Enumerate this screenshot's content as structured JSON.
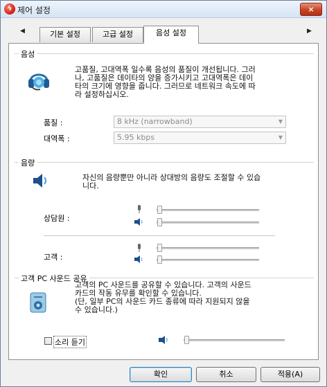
{
  "window": {
    "title": "제어 설정",
    "close_label": "×"
  },
  "tabs": [
    {
      "label": "기본 설정"
    },
    {
      "label": "고급 설정"
    },
    {
      "label": "음성 설정"
    }
  ],
  "active_tab": "음성 설정",
  "voice_group": {
    "title": "음성",
    "description_lines": [
      "고품질, 고대역폭 일수록 음성의 품질이 개선됩니다. 그러",
      "나, 고품질은 데이타의 양을 증가시키고 고대역폭은 데이",
      "타의 크기에 영향을 줍니다. 그러므로 네트워크 속도에 따",
      "라 설정하십시오."
    ],
    "quality_label": "품질 :",
    "quality_value": "8 kHz (narrowband)",
    "bandwidth_label": "대역폭 :",
    "bandwidth_value": "5.95 kbps"
  },
  "volume_group": {
    "title": "음량",
    "description_lines": [
      "자신의 음량뿐만 아니라 상대방의 음량도 조절할 수 있습",
      "니다."
    ],
    "remote_label": "상담원 :",
    "client_label": "고객 :",
    "levels": {
      "remote_mic": 0,
      "remote_speaker": 0,
      "client_mic": 0,
      "client_speaker": 0
    }
  },
  "pc_sound_group": {
    "title": "고객 PC 사운드 공유",
    "description_lines": [
      "고객의 PC 사운드를 공유할 수 있습니다. 고객의 사운드",
      "카드의 작동 유무를 확인할 수 있습니다.",
      "(단, 일부 PC의 사운드 카드 종류에 따라 지원되지 않을",
      "수 있습니다.)"
    ],
    "listen_checkbox_label": "소리 듣기",
    "listen_checked": false,
    "listen_level": 0
  },
  "buttons": {
    "ok": "확인",
    "cancel": "취소",
    "apply": "적용(A)"
  },
  "icons": {
    "app": "app-logo-icon",
    "headset": "headset-icon",
    "speaker": "speaker-icon",
    "mic": "microphone-icon",
    "pc_sound": "computer-sound-icon"
  }
}
